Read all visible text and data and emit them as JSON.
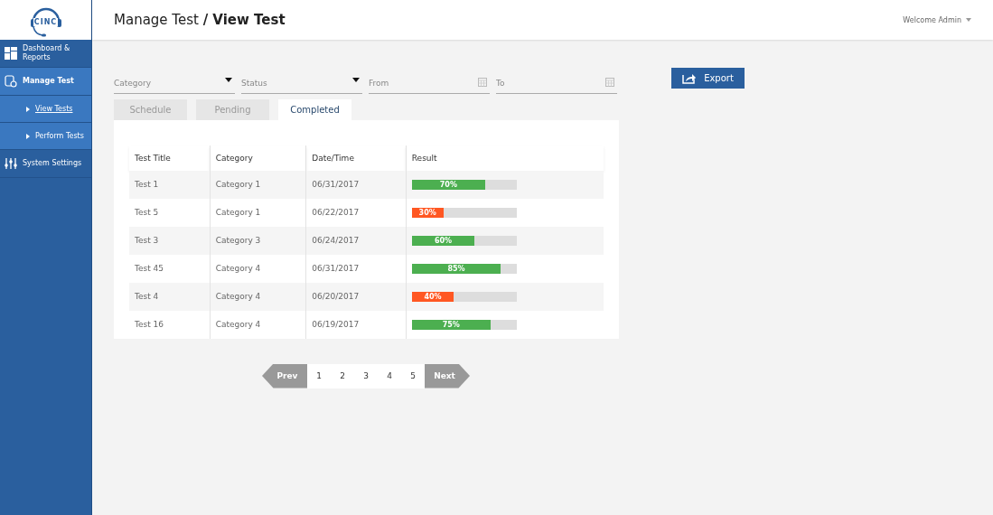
{
  "logo": {
    "text": "CINC"
  },
  "header": {
    "title": "Manage Test",
    "subtitle": "/ View Test",
    "user": "Welcome Admin"
  },
  "sidebar": {
    "items": [
      {
        "kind": "section",
        "label": "Dashboard & Reports",
        "selected": false
      },
      {
        "kind": "section",
        "label": "Manage Test",
        "selected": true
      },
      {
        "kind": "sub",
        "label": "View Tests",
        "selected": true
      },
      {
        "kind": "sub",
        "label": "Perform Tests",
        "selected": false
      },
      {
        "kind": "section",
        "label": "System Settings",
        "selected": false
      }
    ]
  },
  "filters": [
    {
      "kind": "select",
      "placeholder": "Category"
    },
    {
      "kind": "select",
      "placeholder": "Status"
    },
    {
      "kind": "date",
      "placeholder": "From"
    },
    {
      "kind": "date",
      "placeholder": "To"
    }
  ],
  "export_button": "Export",
  "tabs": [
    {
      "label": "Schedule",
      "selected": false
    },
    {
      "label": "Pending",
      "selected": false
    },
    {
      "label": "Completed",
      "selected": true
    }
  ],
  "table": {
    "columns": [
      "Test Title",
      "Category",
      "Date/Time",
      "Result"
    ],
    "rows": [
      {
        "title": "Test 1",
        "category": "Category 1",
        "date": "06/31/2017",
        "result": "70%",
        "level": 0.7,
        "color": "#4caf50"
      },
      {
        "title": "Test 5",
        "category": "Category 1",
        "date": "06/22/2017",
        "result": "30%",
        "level": 0.3,
        "color": "#ff5722"
      },
      {
        "title": "Test 3",
        "category": "Category 3",
        "date": "06/24/2017",
        "result": "60%",
        "level": 0.6,
        "color": "#4caf50"
      },
      {
        "title": "Test 45",
        "category": "Category 4",
        "date": "06/31/2017",
        "result": "85%",
        "level": 0.85,
        "color": "#4caf50"
      },
      {
        "title": "Test 4",
        "category": "Category 4",
        "date": "06/20/2017",
        "result": "40%",
        "level": 0.4,
        "color": "#ff5722"
      },
      {
        "title": "Test 16",
        "category": "Category 4",
        "date": "06/19/2017",
        "result": "75%",
        "level": 0.75,
        "color": "#4caf50"
      }
    ]
  },
  "pagination": {
    "prev": "Prev",
    "pages": [
      "1",
      "2",
      "3",
      "4",
      "5"
    ],
    "next": "Next"
  }
}
